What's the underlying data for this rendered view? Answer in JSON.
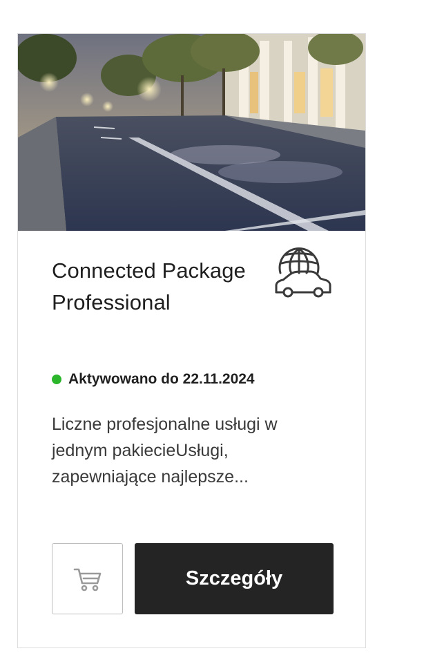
{
  "product": {
    "title": "Connected Package Professional",
    "icon": "globe-car-icon",
    "status_text": "Aktywowano do 22.11.2024",
    "status_color": "#2bb52b",
    "description": "Liczne profesjonalne usługi w jednym pakiecieUsługi, zapewniające najlepsze...",
    "hero_image": "night-city-street"
  },
  "actions": {
    "cart_icon": "cart-icon",
    "details_label": "Szczegóły"
  },
  "colors": {
    "button_dark": "#242424",
    "border": "#dedede",
    "text": "#1f1f1f"
  }
}
